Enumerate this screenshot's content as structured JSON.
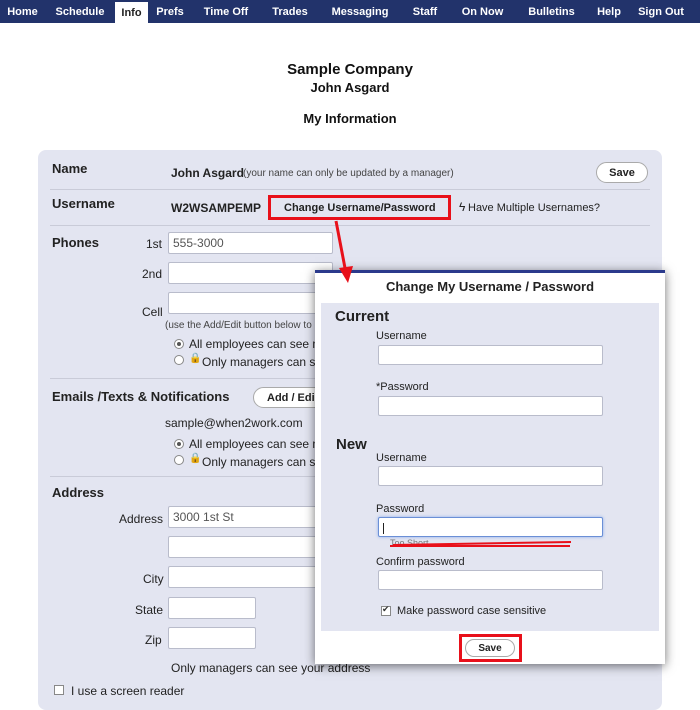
{
  "nav": [
    "Home",
    "Schedule",
    "Info",
    "Prefs",
    "Time Off",
    "Trades",
    "Messaging",
    "Staff",
    "On Now",
    "Bulletins",
    "Help",
    "Sign Out"
  ],
  "nav_active": "Info",
  "header": {
    "company": "Sample Company",
    "employee": "John Asgard",
    "page_title": "My Information"
  },
  "name_row": {
    "label": "Name",
    "value": "John Asgard",
    "note": "(your name can only be updated by a manager)",
    "save": "Save"
  },
  "username_row": {
    "label": "Username",
    "value": "W2WSAMPEMP",
    "change_btn": "Change Username/Password",
    "multi_link": "Have Multiple Usernames?"
  },
  "phones": {
    "label": "Phones",
    "first_label": "1st",
    "first_value": "555-3000",
    "second_label": "2nd",
    "cell_label": "Cell",
    "note": "(use the Add/Edit button below to",
    "vis_all": "All employees can see m",
    "vis_mgr": "Only managers can se"
  },
  "emails": {
    "label": "Emails /Texts & Notifications",
    "add_btn": "Add / Edi",
    "email": "sample@when2work.com",
    "vis_all": "All employees can see m",
    "vis_mgr": "Only managers can se"
  },
  "address": {
    "label": "Address",
    "address_label": "Address",
    "address_value": "3000 1st St",
    "city_label": "City",
    "state_label": "State",
    "zip_label": "Zip",
    "note": "Only managers can see your address"
  },
  "screen_reader": "I use a screen reader",
  "modal": {
    "title": "Change My Username / Password",
    "current": "Current",
    "cur_username": "Username",
    "cur_password": "*Password",
    "new": "New",
    "new_username": "Username",
    "new_password": "Password",
    "strength": "Too Short",
    "confirm": "Confirm password",
    "case_sensitive": "Make password case sensitive",
    "save": "Save"
  },
  "colors": {
    "nav": "#22336b",
    "panel": "#e3e5f1",
    "highlight": "#e8101a"
  }
}
